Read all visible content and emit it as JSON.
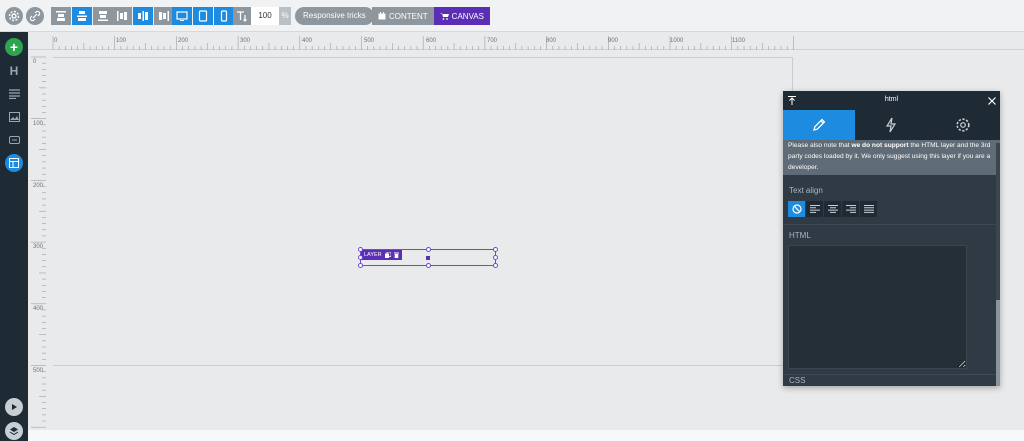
{
  "toolbar": {
    "zoom_value": "100",
    "zoom_unit": "%",
    "responsive_label": "Responsive tricks",
    "content_label": "CONTENT",
    "canvas_label": "CANVAS"
  },
  "rulers": {
    "horizontal": [
      "0",
      "100",
      "200",
      "300",
      "400",
      "500",
      "600",
      "700",
      "800",
      "900",
      "1000",
      "1100"
    ],
    "vertical": [
      "0",
      "100",
      "200",
      "300",
      "400",
      "500"
    ]
  },
  "layer": {
    "tag": "LAYER"
  },
  "panel": {
    "title": "html",
    "notice_pre": "Please also note that ",
    "notice_bold": "we do not support",
    "notice_post": " the HTML layer and the 3rd party codes loaded by it. We only suggest using this layer if you are a developer.",
    "text_align_label": "Text align",
    "html_label": "HTML",
    "css_label": "CSS"
  },
  "colors": {
    "accent": "#1d8be0",
    "canvas_mode": "#5b2fb5",
    "add": "#2ea44f"
  }
}
